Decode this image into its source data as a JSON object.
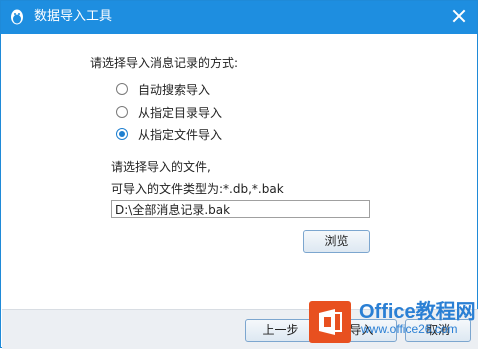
{
  "window": {
    "title": "数据导入工具",
    "accent_color": "#1e8ee0",
    "icons": [
      "qq-penguin-icon",
      "close-icon"
    ]
  },
  "main": {
    "prompt": "请选择导入消息记录的方式:",
    "options": [
      {
        "label": "自动搜索导入",
        "checked": false
      },
      {
        "label": "从指定目录导入",
        "checked": false
      },
      {
        "label": "从指定文件导入",
        "checked": true
      }
    ],
    "file_prompt": "请选择导入的文件,",
    "file_types": "可导入的文件类型为:*.db,*.bak",
    "file_path": "D:\\全部消息记录.bak",
    "browse_label": "浏览"
  },
  "footer": {
    "prev_label": "上一步",
    "import_label": "导入",
    "cancel_label": "取消"
  },
  "watermark": {
    "line1": "Office教程网",
    "line2": "www.office26.com"
  }
}
